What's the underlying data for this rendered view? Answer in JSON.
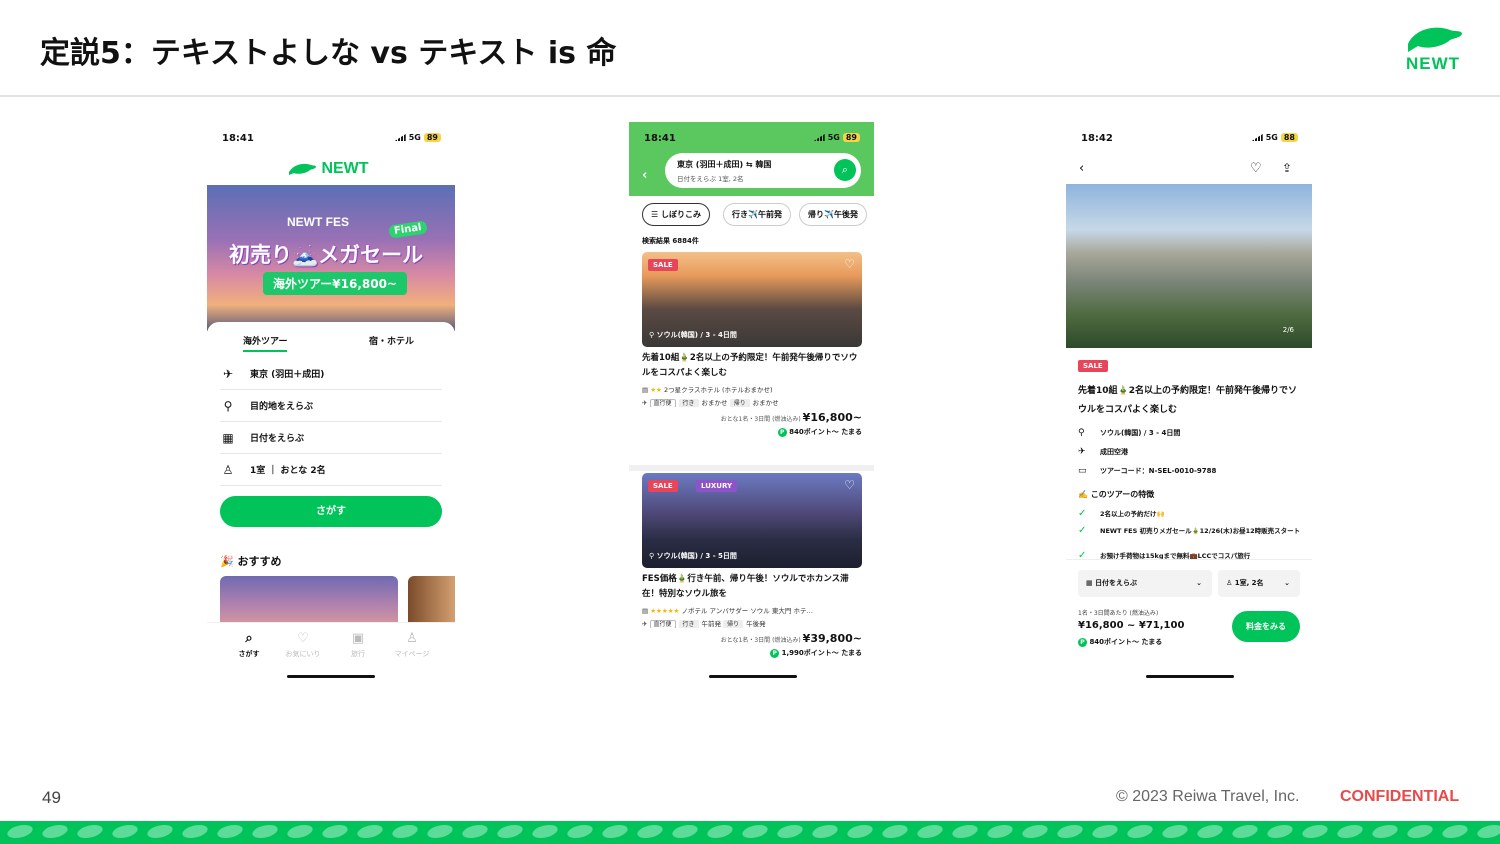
{
  "slide": {
    "title": "定説5：テキストよしな vs テキスト is 命",
    "page_number": "49",
    "copyright": "© 2023 Reiwa Travel, Inc.",
    "confidential": "CONFIDENTIAL",
    "logo_text": "NEWT"
  },
  "colors": {
    "brand_green": "#00c45a",
    "sale_red": "#e8445a",
    "luxury_purple": "#8d53c8",
    "confidential_red": "#e84a4a"
  },
  "phone1": {
    "time": "18:41",
    "network": "5G",
    "battery": "89",
    "brand": "NEWT",
    "banner": {
      "fes": "NEWT FES",
      "final": "Final",
      "headline": "初売り🗻メガセール",
      "price_pill": "海外ツアー¥16,800~"
    },
    "tabs": [
      "海外ツアー",
      "宿・ホテル"
    ],
    "fields": [
      {
        "icon": "departure-icon",
        "value": "東京 (羽田＋成田)"
      },
      {
        "icon": "location-pin-icon",
        "value": "目的地をえらぶ"
      },
      {
        "icon": "calendar-icon",
        "value": "日付をえらぶ"
      },
      {
        "icon": "person-icon",
        "value": "1室 ｜ おとな 2名"
      }
    ],
    "search_button": "さがす",
    "recommend": "🎉 おすすめ",
    "tabbar": [
      "さがす",
      "お気にいり",
      "旅行",
      "マイページ"
    ]
  },
  "phone2": {
    "time": "18:41",
    "network": "5G",
    "battery": "89",
    "search": {
      "route": "東京 (羽田＋成田) ⇆ 韓国",
      "sub": "日付をえらぶ 1室, 2名"
    },
    "chips": [
      "しぼりこみ",
      "行き✈️午前発",
      "帰り✈️午後発"
    ],
    "result_count": "検索結果 6884件",
    "cards": [
      {
        "badges": [
          "SALE"
        ],
        "location": "ソウル(韓国) / 3 - 4日間",
        "title": "先着10組🎍2名以上の予約限定！午前発午後帰りでソウルをコスパよく楽しむ",
        "stars": "★★",
        "hotel": "2つ星クラスホテル (ホテルおまかせ)",
        "flight_tag": "直行便",
        "out_tag": "行き",
        "out_value": "おまかせ",
        "back_tag": "帰り",
        "back_value": "おまかせ",
        "price_note": "おとな1名・3日間 (燃油込み)",
        "price": "¥16,800~",
        "points": "840ポイント～ たまる"
      },
      {
        "badges": [
          "SALE",
          "LUXURY"
        ],
        "location": "ソウル(韓国) / 3 - 5日間",
        "title": "FES価格🎍行き午前、帰り午後！ソウルでホカンス滞在！特別なソウル旅を",
        "stars": "★★★★★",
        "hotel": "ノボテル アンバサダー ソウル 東大門 ホテ…",
        "flight_tag": "直行便",
        "out_tag": "行き",
        "out_value": "午前発",
        "back_tag": "帰り",
        "back_value": "午後発",
        "price_note": "おとな1名・3日間 (燃油込み)",
        "price": "¥39,800~",
        "points": "1,990ポイント～ たまる"
      }
    ]
  },
  "phone3": {
    "time": "18:42",
    "network": "5G",
    "battery": "88",
    "image_index": "2/6",
    "sale": "SALE",
    "title": "先着10組🎍2名以上の予約限定！午前発午後帰りでソウルをコスパよく楽しむ",
    "info": [
      {
        "icon": "location-pin-icon",
        "text": "ソウル(韓国) / 3 - 4日間"
      },
      {
        "icon": "departure-icon",
        "text": "成田空港"
      },
      {
        "icon": "ticket-icon",
        "text": "ツアーコード：N-SEL-0010-9788"
      }
    ],
    "features_title": "✍️ このツアーの特徴",
    "features": [
      "2名以上の予約だけ🙌",
      "NEWT FES 初売りメガセール🎍12/26(木)お昼12時販売スタート",
      "お預け手荷物は15kgまで無料💼LCCでコスパ旅行"
    ],
    "date_select": "日付をえらぶ",
    "room_select": "1室, 2名",
    "price_note": "1名・3日間あたり (燃油込み)",
    "price_range": "¥16,800 ~ ¥71,100",
    "points": "840ポイント～ たまる",
    "cta": "料金をみる"
  }
}
